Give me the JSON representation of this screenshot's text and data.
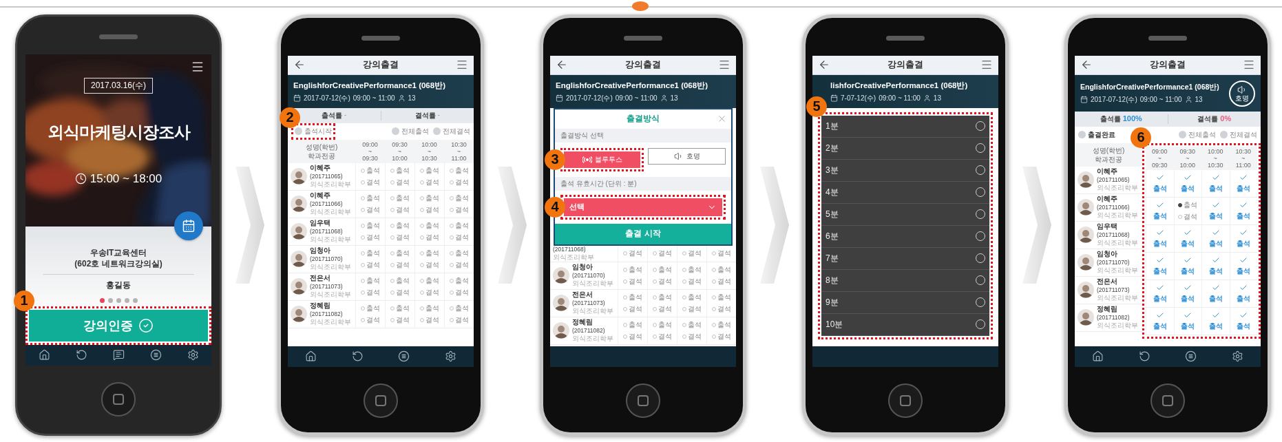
{
  "phones": [
    {
      "kind": "home",
      "date": "2017.03.16(수)",
      "title": "외식마케팅시장조사",
      "time": "15:00 ~ 18:00",
      "place": "우송IT교육센터",
      "room": "(602호 네트워크강의실)",
      "instructor": "홍길동",
      "pages": [
        {
          "selected": true
        },
        {
          "selected": false
        },
        {
          "selected": false
        },
        {
          "selected": false
        },
        {
          "selected": false
        }
      ],
      "action": {
        "label": "강의인증",
        "callout": "1"
      },
      "nav": [
        {
          "kind": "home"
        },
        {
          "kind": "refresh"
        },
        {
          "kind": "chat"
        },
        {
          "kind": "list"
        },
        {
          "kind": "settings"
        }
      ]
    },
    {
      "kind": "attendance",
      "screen_title": "강의출결",
      "course": "EnglishforCreativePerformance1 (068반)",
      "date": "2017-07-12(수)",
      "time": "09:00 ~ 11:00",
      "count": "13",
      "rates": [
        {
          "label": "출석률",
          "value": "-"
        },
        {
          "label": "결석률",
          "value": "-"
        }
      ],
      "start_option": {
        "label": "출석시작",
        "checked": false,
        "callout": "2"
      },
      "bulk_options": [
        {
          "label": "전체출석",
          "checked": false
        },
        {
          "label": "전체결석",
          "checked": false
        }
      ],
      "table": {
        "name_header": "성명(학번)",
        "dept_header": "학과전공",
        "columns": [
          {
            "start": "09:00",
            "sep": "~",
            "end": "09:30"
          },
          {
            "start": "09:30",
            "sep": "~",
            "end": "10:00"
          },
          {
            "start": "10:00",
            "sep": "~",
            "end": "10:30"
          },
          {
            "start": "10:30",
            "sep": "~",
            "end": "11:00"
          }
        ],
        "rows": [
          {
            "name": "이혜주",
            "id": "(201711065)",
            "dept": "외식조리학부",
            "slots": [
              {
                "kind": "radio",
                "options": [
                  {
                    "label": "출석",
                    "selected": false
                  },
                  {
                    "label": "결석",
                    "selected": false
                  }
                ]
              },
              {
                "kind": "radio",
                "options": [
                  {
                    "label": "출석",
                    "selected": false
                  },
                  {
                    "label": "결석",
                    "selected": false
                  }
                ]
              },
              {
                "kind": "radio",
                "options": [
                  {
                    "label": "출석",
                    "selected": false
                  },
                  {
                    "label": "결석",
                    "selected": false
                  }
                ]
              },
              {
                "kind": "radio",
                "options": [
                  {
                    "label": "출석",
                    "selected": false
                  },
                  {
                    "label": "결석",
                    "selected": false
                  }
                ]
              }
            ]
          },
          {
            "name": "이혜주",
            "id": "(201711066)",
            "dept": "외식조리학부",
            "slots": [
              {
                "kind": "radio",
                "options": [
                  {
                    "label": "출석",
                    "selected": false
                  },
                  {
                    "label": "결석",
                    "selected": false
                  }
                ]
              },
              {
                "kind": "radio",
                "options": [
                  {
                    "label": "출석",
                    "selected": false
                  },
                  {
                    "label": "결석",
                    "selected": false
                  }
                ]
              },
              {
                "kind": "radio",
                "options": [
                  {
                    "label": "출석",
                    "selected": false
                  },
                  {
                    "label": "결석",
                    "selected": false
                  }
                ]
              },
              {
                "kind": "radio",
                "options": [
                  {
                    "label": "출석",
                    "selected": false
                  },
                  {
                    "label": "결석",
                    "selected": false
                  }
                ]
              }
            ]
          },
          {
            "name": "임우택",
            "id": "(201711068)",
            "dept": "외식조리학부",
            "slots": [
              {
                "kind": "radio",
                "options": [
                  {
                    "label": "출석",
                    "selected": false
                  },
                  {
                    "label": "결석",
                    "selected": false
                  }
                ]
              },
              {
                "kind": "radio",
                "options": [
                  {
                    "label": "출석",
                    "selected": false
                  },
                  {
                    "label": "결석",
                    "selected": false
                  }
                ]
              },
              {
                "kind": "radio",
                "options": [
                  {
                    "label": "출석",
                    "selected": false
                  },
                  {
                    "label": "결석",
                    "selected": false
                  }
                ]
              },
              {
                "kind": "radio",
                "options": [
                  {
                    "label": "출석",
                    "selected": false
                  },
                  {
                    "label": "결석",
                    "selected": false
                  }
                ]
              }
            ]
          },
          {
            "name": "임청아",
            "id": "(201711070)",
            "dept": "외식조리학부",
            "slots": [
              {
                "kind": "radio",
                "options": [
                  {
                    "label": "출석",
                    "selected": false
                  },
                  {
                    "label": "결석",
                    "selected": false
                  }
                ]
              },
              {
                "kind": "radio",
                "options": [
                  {
                    "label": "출석",
                    "selected": false
                  },
                  {
                    "label": "결석",
                    "selected": false
                  }
                ]
              },
              {
                "kind": "radio",
                "options": [
                  {
                    "label": "출석",
                    "selected": false
                  },
                  {
                    "label": "결석",
                    "selected": false
                  }
                ]
              },
              {
                "kind": "radio",
                "options": [
                  {
                    "label": "출석",
                    "selected": false
                  },
                  {
                    "label": "결석",
                    "selected": false
                  }
                ]
              }
            ]
          },
          {
            "name": "전은서",
            "id": "(201711073)",
            "dept": "외식조리학부",
            "slots": [
              {
                "kind": "radio",
                "options": [
                  {
                    "label": "출석",
                    "selected": false
                  },
                  {
                    "label": "결석",
                    "selected": false
                  }
                ]
              },
              {
                "kind": "radio",
                "options": [
                  {
                    "label": "출석",
                    "selected": false
                  },
                  {
                    "label": "결석",
                    "selected": false
                  }
                ]
              },
              {
                "kind": "radio",
                "options": [
                  {
                    "label": "출석",
                    "selected": false
                  },
                  {
                    "label": "결석",
                    "selected": false
                  }
                ]
              },
              {
                "kind": "radio",
                "options": [
                  {
                    "label": "출석",
                    "selected": false
                  },
                  {
                    "label": "결석",
                    "selected": false
                  }
                ]
              }
            ]
          },
          {
            "name": "정혜림",
            "id": "(201711082)",
            "dept": "외식조리학부",
            "slots": [
              {
                "kind": "radio",
                "options": [
                  {
                    "label": "출석",
                    "selected": false
                  },
                  {
                    "label": "결석",
                    "selected": false
                  }
                ]
              },
              {
                "kind": "radio",
                "options": [
                  {
                    "label": "출석",
                    "selected": false
                  },
                  {
                    "label": "결석",
                    "selected": false
                  }
                ]
              },
              {
                "kind": "radio",
                "options": [
                  {
                    "label": "출석",
                    "selected": false
                  },
                  {
                    "label": "결석",
                    "selected": false
                  }
                ]
              },
              {
                "kind": "radio",
                "options": [
                  {
                    "label": "출석",
                    "selected": false
                  },
                  {
                    "label": "결석",
                    "selected": false
                  }
                ]
              }
            ]
          }
        ]
      },
      "nav": [
        {
          "kind": "home"
        },
        {
          "kind": "refresh"
        },
        {
          "kind": "list"
        },
        {
          "kind": "settings"
        }
      ]
    },
    {
      "kind": "method",
      "screen_title": "강의출결",
      "course": "EnglishforCreativePerformance1 (068반)",
      "date": "2017-07-12(수)",
      "time": "09:00 ~ 11:00",
      "count": "13",
      "dialog": {
        "title": "출결방식",
        "method_label": "출결방식 선택",
        "methods": [
          {
            "kind": "bluetooth",
            "label": "블루투스",
            "selected": true,
            "callout": "3"
          },
          {
            "kind": "voice",
            "label": "호명",
            "selected": false
          }
        ],
        "duration_label": "출석 유효시간 (단위 : 분)",
        "select": {
          "value": "선택",
          "callout": "4"
        },
        "submit": "출결 시작"
      },
      "table": {
        "rows": [
          {
            "id": "(201711068)",
            "dept": "외식조리학부",
            "slots": [
              {
                "kind": "radio",
                "options": [
                  {
                    "label": "결석",
                    "selected": false
                  }
                ]
              },
              {
                "kind": "radio",
                "options": [
                  {
                    "label": "결석",
                    "selected": false
                  }
                ]
              },
              {
                "kind": "radio",
                "options": [
                  {
                    "label": "결석",
                    "selected": false
                  }
                ]
              },
              {
                "kind": "radio",
                "options": [
                  {
                    "label": "결석",
                    "selected": false
                  }
                ]
              }
            ]
          },
          {
            "name": "임청아",
            "id": "(201711070)",
            "dept": "외식조리학부",
            "slots": [
              {
                "kind": "radio",
                "options": [
                  {
                    "label": "출석",
                    "selected": false
                  },
                  {
                    "label": "결석",
                    "selected": false
                  }
                ]
              },
              {
                "kind": "radio",
                "options": [
                  {
                    "label": "출석",
                    "selected": false
                  },
                  {
                    "label": "결석",
                    "selected": false
                  }
                ]
              },
              {
                "kind": "radio",
                "options": [
                  {
                    "label": "출석",
                    "selected": false
                  },
                  {
                    "label": "결석",
                    "selected": false
                  }
                ]
              },
              {
                "kind": "radio",
                "options": [
                  {
                    "label": "출석",
                    "selected": false
                  },
                  {
                    "label": "결석",
                    "selected": false
                  }
                ]
              }
            ]
          },
          {
            "name": "전은서",
            "id": "(201711073)",
            "dept": "외식조리학부",
            "slots": [
              {
                "kind": "radio",
                "options": [
                  {
                    "label": "출석",
                    "selected": false
                  },
                  {
                    "label": "결석",
                    "selected": false
                  }
                ]
              },
              {
                "kind": "radio",
                "options": [
                  {
                    "label": "출석",
                    "selected": false
                  },
                  {
                    "label": "결석",
                    "selected": false
                  }
                ]
              },
              {
                "kind": "radio",
                "options": [
                  {
                    "label": "출석",
                    "selected": false
                  },
                  {
                    "label": "결석",
                    "selected": false
                  }
                ]
              },
              {
                "kind": "radio",
                "options": [
                  {
                    "label": "출석",
                    "selected": false
                  },
                  {
                    "label": "결석",
                    "selected": false
                  }
                ]
              }
            ]
          },
          {
            "name": "정혜림",
            "id": "(201711082)",
            "dept": "외식조리학부",
            "slots": [
              {
                "kind": "radio",
                "options": [
                  {
                    "label": "출석",
                    "selected": false
                  },
                  {
                    "label": "결석",
                    "selected": false
                  }
                ]
              },
              {
                "kind": "radio",
                "options": [
                  {
                    "label": "출석",
                    "selected": false
                  },
                  {
                    "label": "결석",
                    "selected": false
                  }
                ]
              },
              {
                "kind": "radio",
                "options": [
                  {
                    "label": "출석",
                    "selected": false
                  },
                  {
                    "label": "결석",
                    "selected": false
                  }
                ]
              },
              {
                "kind": "radio",
                "options": [
                  {
                    "label": "출석",
                    "selected": false
                  },
                  {
                    "label": "결석",
                    "selected": false
                  }
                ]
              }
            ]
          }
        ]
      }
    },
    {
      "kind": "picker",
      "screen_title": "강의출결",
      "course": "lishforCreativePerformance1 (068반)",
      "date": "7-07-12(수)",
      "time": "09:00 ~ 11:00",
      "count": "13",
      "callout": "5",
      "minutes": [
        {
          "label": "1분",
          "selected": false
        },
        {
          "label": "2분",
          "selected": false
        },
        {
          "label": "3분",
          "selected": false
        },
        {
          "label": "4분",
          "selected": false
        },
        {
          "label": "5분",
          "selected": false
        },
        {
          "label": "6분",
          "selected": false
        },
        {
          "label": "7분",
          "selected": false
        },
        {
          "label": "8분",
          "selected": false
        },
        {
          "label": "9분",
          "selected": false
        },
        {
          "label": "10분",
          "selected": false
        }
      ]
    },
    {
      "kind": "attendance",
      "screen_title": "강의출결",
      "course": "EnglishforCreativePerformance1 (068반)",
      "date": "2017-07-12(수)",
      "time": "09:00 ~ 11:00",
      "count": "13",
      "call_button": "호명",
      "rates": [
        {
          "label": "출석률",
          "value": "100%",
          "color": "#2b8fd6"
        },
        {
          "label": "결석률",
          "value": "0%",
          "color": "#ec5b86"
        }
      ],
      "start_option": {
        "label": "출결완료",
        "checked": false
      },
      "bulk_options": [
        {
          "label": "전체출석",
          "checked": false
        },
        {
          "label": "전체결석",
          "checked": false
        }
      ],
      "table": {
        "name_header": "성명(학번)",
        "dept_header": "학과전공",
        "callout": "6",
        "columns": [
          {
            "start": "09:00",
            "sep": "~",
            "end": "09:30"
          },
          {
            "start": "09:30",
            "sep": "~",
            "end": "10:00"
          },
          {
            "start": "10:00",
            "sep": "~",
            "end": "10:30"
          },
          {
            "start": "10:30",
            "sep": "~",
            "end": "11:00"
          }
        ],
        "rows": [
          {
            "name": "이혜주",
            "id": "(201711065)",
            "dept": "외식조리학부",
            "slots": [
              {
                "kind": "check",
                "label": "출석"
              },
              {
                "kind": "check",
                "label": "출석"
              },
              {
                "kind": "check",
                "label": "출석"
              },
              {
                "kind": "check",
                "label": "출석"
              }
            ]
          },
          {
            "name": "이혜주",
            "id": "(201711066)",
            "dept": "외식조리학부",
            "slots": [
              {
                "kind": "check",
                "label": "출석"
              },
              {
                "kind": "radio",
                "options": [
                  {
                    "label": "출석",
                    "selected": true
                  },
                  {
                    "label": "결석",
                    "selected": false
                  }
                ]
              },
              {
                "kind": "check",
                "label": "출석"
              },
              {
                "kind": "check",
                "label": "출석"
              }
            ]
          },
          {
            "name": "임우택",
            "id": "(201711068)",
            "dept": "외식조리학부",
            "slots": [
              {
                "kind": "check",
                "label": "출석"
              },
              {
                "kind": "check",
                "label": "출석"
              },
              {
                "kind": "check",
                "label": "출석"
              },
              {
                "kind": "check",
                "label": "출석"
              }
            ]
          },
          {
            "name": "임청아",
            "id": "(201711070)",
            "dept": "외식조리학부",
            "slots": [
              {
                "kind": "check",
                "label": "출석"
              },
              {
                "kind": "check",
                "label": "출석"
              },
              {
                "kind": "check",
                "label": "출석"
              },
              {
                "kind": "check",
                "label": "출석"
              }
            ]
          },
          {
            "name": "전은서",
            "id": "(201711073)",
            "dept": "외식조리학부",
            "slots": [
              {
                "kind": "check",
                "label": "출석"
              },
              {
                "kind": "check",
                "label": "출석"
              },
              {
                "kind": "check",
                "label": "출석"
              },
              {
                "kind": "check",
                "label": "출석"
              }
            ]
          },
          {
            "name": "정혜림",
            "id": "(201711082)",
            "dept": "외식조리학부",
            "slots": [
              {
                "kind": "check",
                "label": "출석"
              },
              {
                "kind": "check",
                "label": "출석"
              },
              {
                "kind": "check",
                "label": "출석"
              },
              {
                "kind": "check",
                "label": "출석"
              }
            ]
          }
        ]
      },
      "nav": [
        {
          "kind": "home"
        },
        {
          "kind": "refresh"
        },
        {
          "kind": "list"
        },
        {
          "kind": "settings"
        }
      ]
    }
  ]
}
